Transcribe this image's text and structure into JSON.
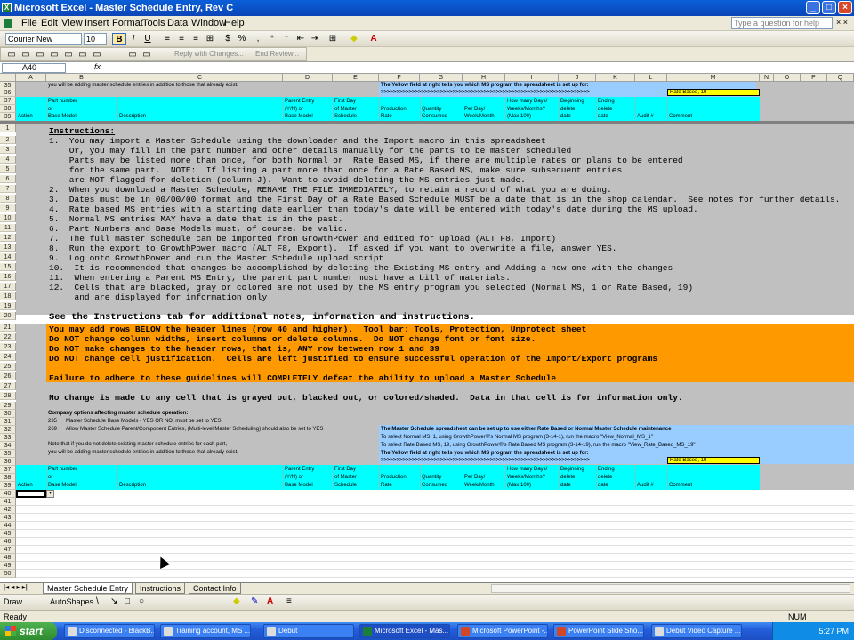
{
  "window": {
    "title": "Microsoft Excel - Master Schedule Entry, Rev C"
  },
  "menu": {
    "items": [
      "File",
      "Edit",
      "View",
      "Insert",
      "Format",
      "Tools",
      "Data",
      "Window",
      "Help"
    ],
    "help_placeholder": "Type a question for help"
  },
  "toolbar": {
    "font": "Courier New",
    "size": "10",
    "bold": "B",
    "italic": "I",
    "underline": "U",
    "currency": "$",
    "percent": "%"
  },
  "toolbar2": {
    "reply": "Reply with Changes...",
    "end_review": "End Review..."
  },
  "formula": {
    "namebox": "A40",
    "fx": "fx"
  },
  "columns": [
    "A",
    "B",
    "C",
    "D",
    "E",
    "F",
    "G",
    "H",
    "I",
    "J",
    "K",
    "L",
    "M",
    "N",
    "O",
    "P",
    "Q"
  ],
  "top_rows": {
    "r35_text": "you will be adding master schedule entries in addition to those that already exist.",
    "yellow_note": "The Yellow field at right tells you which MS program the spreadsheet is set up for:",
    "arrows": ">>>>>>>>>>>>>>>>>>>>>>>>>>>>>>>>>>>>>>>>>>>>>>>>>>>>>>>>>>>>>>>>>>>",
    "rate_based": "Rate Based, 19"
  },
  "header_labels": {
    "action": "Action",
    "part_number": "Part number",
    "or": "or",
    "base_model": "Base Model",
    "description": "Description",
    "parent_entry_1": "Parent Entry",
    "parent_entry_2": "(Y/N) or",
    "parent_entry_3": "Base Model",
    "first_day_1": "First Day",
    "first_day_2": "of Master",
    "first_day_3": "Schedule",
    "production_rate_1": "Production",
    "production_rate_2": "Rate",
    "quantity_1": "Quantity",
    "quantity_2": "Consumed",
    "per_day_1": "Per Day/",
    "per_day_2": "Week/Month",
    "how_many_1": "How many Days/",
    "how_many_2": "Weeks/Months?",
    "how_many_3": "(Max 100)",
    "beginning_1": "Beginning",
    "beginning_2": "delete",
    "beginning_3": "date",
    "ending_1": "Ending",
    "ending_2": "delete",
    "ending_3": "date",
    "audit": "Audit #",
    "comment": "Comment"
  },
  "instructions": {
    "heading": "Instructions:",
    "lines": [
      "1.  You may import a Master Schedule using the downloader and the Import macro in this spreadsheet",
      "    Or, you may fill in the part number and other details manually for the parts to be master scheduled",
      "    Parts may be listed more than once, for both Normal or  Rate Based MS, if there are multiple rates or plans to be entered",
      "    for the same part.  NOTE:  If listing a part more than once for a Rate Based MS, make sure subsequent entries",
      "    are NOT flagged for deletion (column J).  Want to avoid deleting the MS entries just made.",
      "2.  When you download a Master Schedule, RENAME THE FILE IMMEDIATELY, to retain a record of what you are doing.",
      "3.  Dates must be in 00/00/00 format and the First Day of a Rate Based Schedule MUST be a date that is in the shop calendar.  See notes for further details.",
      "4.  Rate based MS entries with a starting date earlier than today's date will be entered with today's date during the MS upload.",
      "5.  Normal MS entries MAY have a date that is in the past.",
      "6.  Part Numbers and Base Models must, of course, be valid.",
      "7.  The full master schedule can be imported from GrowthPower and edited for upload (ALT F8, Import)",
      "8.  Run the export to GrowthPower macro (ALT F8, Export).  If asked if you want to overwrite a file, answer YES.",
      "9.  Log onto GrowthPower and run the Master Schedule upload script",
      "10.  It is recommended that changes be accomplished by deleting the Existing MS entry and Adding a new one with the changes",
      "11.  When entering a Parent MS Entry, the parent part number must have a bill of materials.",
      "12.  Cells that are blacked, gray or colored are not used by the MS entry program you selected (Normal MS, 1 or Rate Based, 19)",
      "     and are displayed for information only"
    ],
    "see_tab": "See the Instructions tab for additional notes, information and instructions.",
    "orange_lines": [
      "You may add rows BELOW the header lines (row 40 and higher).  Tool bar: Tools, Protection, Unprotect sheet",
      "Do NOT change column widths, insert columns or delete columns.  Do NOT change font or font size.",
      "Do NOT make changes to the header rows, that is, ANY row between row 1 and 39",
      "Do NOT change cell justification.  Cells are left justified to ensure successful operation of the Import/Export programs",
      "",
      "Failure to adhere to these guidelines will COMPLETELY defeat the ability to upload a Master Schedule"
    ],
    "no_change": "No change is made to any cell that is grayed out, blacked out, or colored/shaded.  Data in that cell is for information only."
  },
  "options": {
    "title": "Company options affecting master schedule operation:",
    "opt1_num": "235",
    "opt1_text": "Master Schedule Base Models - YES OR NO, must be set to YES",
    "opt2_num": "269",
    "opt2_text": "Allow Master Schedule Parent/Component Entries, (Multi-level Master Scheduling) should also be set to YES",
    "note1": "Note that if you do not delete existing master schedule entries for each part,",
    "note2": "you will be adding master schedule entries in addition to those that already exist."
  },
  "blue_box": {
    "l1": "The Master Schedule spreadsheet can be set up to use either Rate Based or Normal Master Schedule maintenance",
    "l2": "To select Normal MS, 1, using GrowthPower®'s Normal MS program (3-14-1), run the macro \"View_Normal_MS_1\"",
    "l3": "To select Rate Based MS, 19, using GrowthPower®'s Rate Based MS program (3-14-19), run the macro \"View_Rate_Based_MS_19\"",
    "l4": "The Yellow field at right tells you which MS program the spreadsheet is set up for:"
  },
  "sheet_tabs": [
    "Master Schedule Entry",
    "Instructions",
    "Contact Info"
  ],
  "drawbar": {
    "draw": "Draw",
    "autoshapes": "AutoShapes"
  },
  "status": {
    "left": "Ready",
    "num": "NUM"
  },
  "taskbar": {
    "start": "start",
    "tasks": [
      "Disconnected - BlackB...",
      "Training account, MS ...",
      "Debut",
      "Microsoft Excel - Mas...",
      "Microsoft PowerPoint -...",
      "PowerPoint Slide Sho...",
      "Debut Video Capture ..."
    ],
    "time": "5:27 PM"
  },
  "colors": {
    "cyan": "#00ffff",
    "gray": "#c0c0c0",
    "orange": "#ff9900",
    "yellow": "#ffff00",
    "lightblue": "#99ccff"
  }
}
